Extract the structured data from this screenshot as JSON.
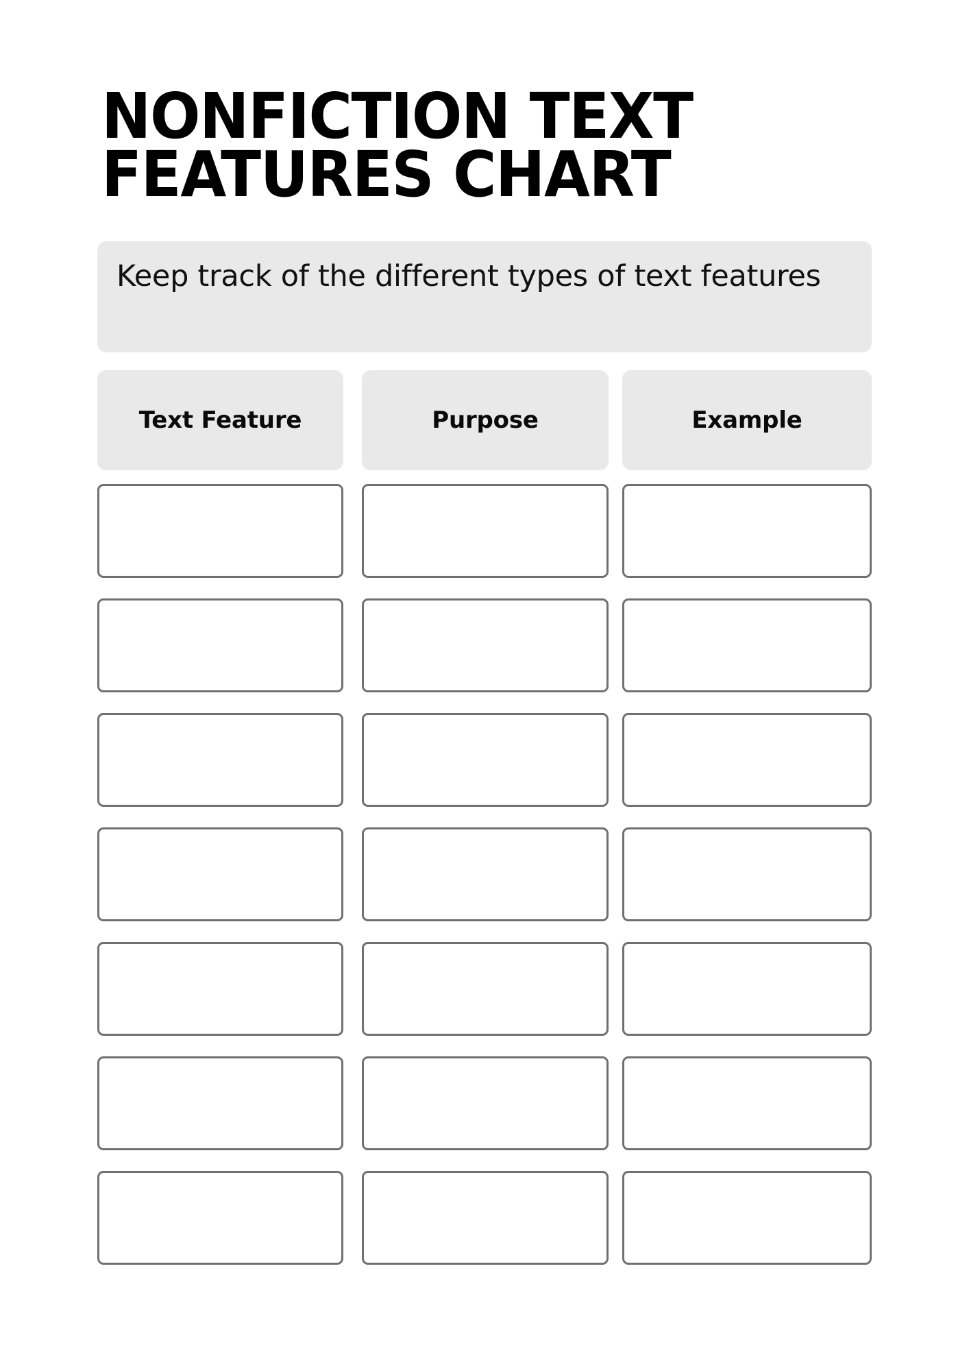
{
  "document": {
    "title_lines": [
      "NONFICTION TEXT",
      "FEATURES CHART"
    ],
    "subtitle": "Keep track of the different types of text features"
  },
  "table": {
    "columns": [
      {
        "label": "Text Feature"
      },
      {
        "label": "Purpose"
      },
      {
        "label": "Example"
      }
    ],
    "rows": [
      {
        "text_feature": "",
        "purpose": "",
        "example": ""
      },
      {
        "text_feature": "",
        "purpose": "",
        "example": ""
      },
      {
        "text_feature": "",
        "purpose": "",
        "example": ""
      },
      {
        "text_feature": "",
        "purpose": "",
        "example": ""
      },
      {
        "text_feature": "",
        "purpose": "",
        "example": ""
      },
      {
        "text_feature": "",
        "purpose": "",
        "example": ""
      },
      {
        "text_feature": "",
        "purpose": "",
        "example": ""
      }
    ],
    "row_count": 7
  },
  "colors": {
    "page_background": "#ffffff",
    "panel_fill": "#e9e9e9",
    "cell_border": "#707070",
    "text": "#000000"
  }
}
